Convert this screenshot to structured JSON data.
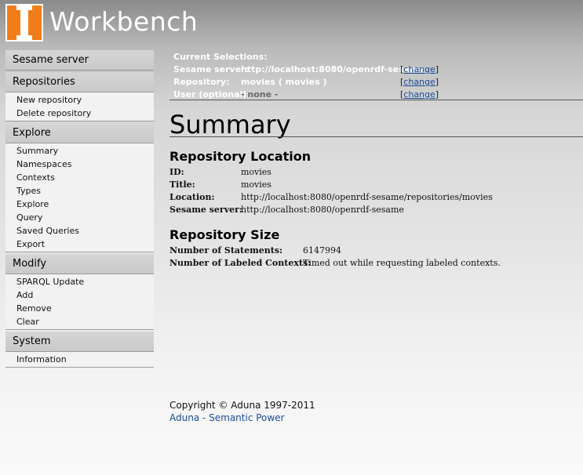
{
  "header": {
    "title": "Workbench",
    "logo_color": "#f07d1a"
  },
  "sidebar": {
    "server_heading": "Sesame server",
    "repositories": {
      "heading": "Repositories",
      "items": [
        "New repository",
        "Delete repository"
      ]
    },
    "explore": {
      "heading": "Explore",
      "items": [
        "Summary",
        "Namespaces",
        "Contexts",
        "Types",
        "Explore",
        "Query",
        "Saved Queries",
        "Export"
      ]
    },
    "modify": {
      "heading": "Modify",
      "items": [
        "SPARQL Update",
        "Add",
        "Remove",
        "Clear"
      ]
    },
    "system": {
      "heading": "System",
      "items": [
        "Information"
      ]
    }
  },
  "selections": {
    "heading": "Current Selections:",
    "server_label": "Sesame server:",
    "server_value": "http://localhost:8080/openrdf-sesame",
    "repository_label": "Repository:",
    "repository_value": "movies ( movies )",
    "user_label": "User (optional):",
    "user_value": "- none -",
    "change_link": "change"
  },
  "main": {
    "title": "Summary",
    "location": {
      "heading": "Repository Location",
      "id_label": "ID:",
      "id_value": "movies",
      "title_label": "Title:",
      "title_value": "movies",
      "location_label": "Location:",
      "location_value": "http://localhost:8080/openrdf-sesame/repositories/movies",
      "server_label": "Sesame server:",
      "server_value": "http://localhost:8080/openrdf-sesame"
    },
    "size": {
      "heading": "Repository Size",
      "statements_label": "Number of Statements:",
      "statements_value": "6147994",
      "contexts_label": "Number of Labeled Contexts:",
      "contexts_value": "Timed out while requesting labeled contexts."
    }
  },
  "footer": {
    "copyright": "Copyright © Aduna 1997-2011",
    "link": "Aduna - Semantic Power"
  },
  "colors": {
    "link": "#1a4c9b",
    "accent": "#f07d1a"
  }
}
